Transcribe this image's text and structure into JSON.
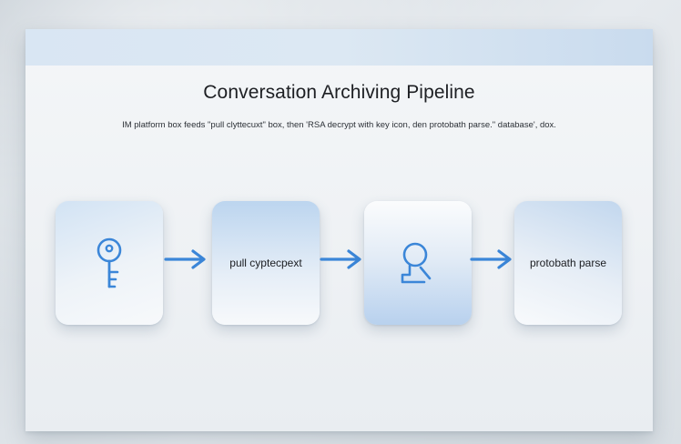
{
  "diagram": {
    "title": "Conversation Archiving Pipeline",
    "subtitle": "IM platform box feeds \"pull clyttecuxt\" box, then 'RSA decrypt with key icon, den protobath parse.\" database', dox.",
    "nodes": [
      {
        "id": "key",
        "icon": "key-icon",
        "label": ""
      },
      {
        "id": "pull",
        "icon": "",
        "label": "pull cyptecpext"
      },
      {
        "id": "person",
        "icon": "person-icon",
        "label": ""
      },
      {
        "id": "parse",
        "icon": "",
        "label": "protobath parse"
      }
    ],
    "edges": [
      {
        "from": "key",
        "to": "pull"
      },
      {
        "from": "pull",
        "to": "person"
      },
      {
        "from": "person",
        "to": "parse"
      }
    ],
    "colors": {
      "accent": "#3b86d8",
      "title_text": "#1d1f23",
      "top_bar": "#d9e6f3"
    }
  }
}
